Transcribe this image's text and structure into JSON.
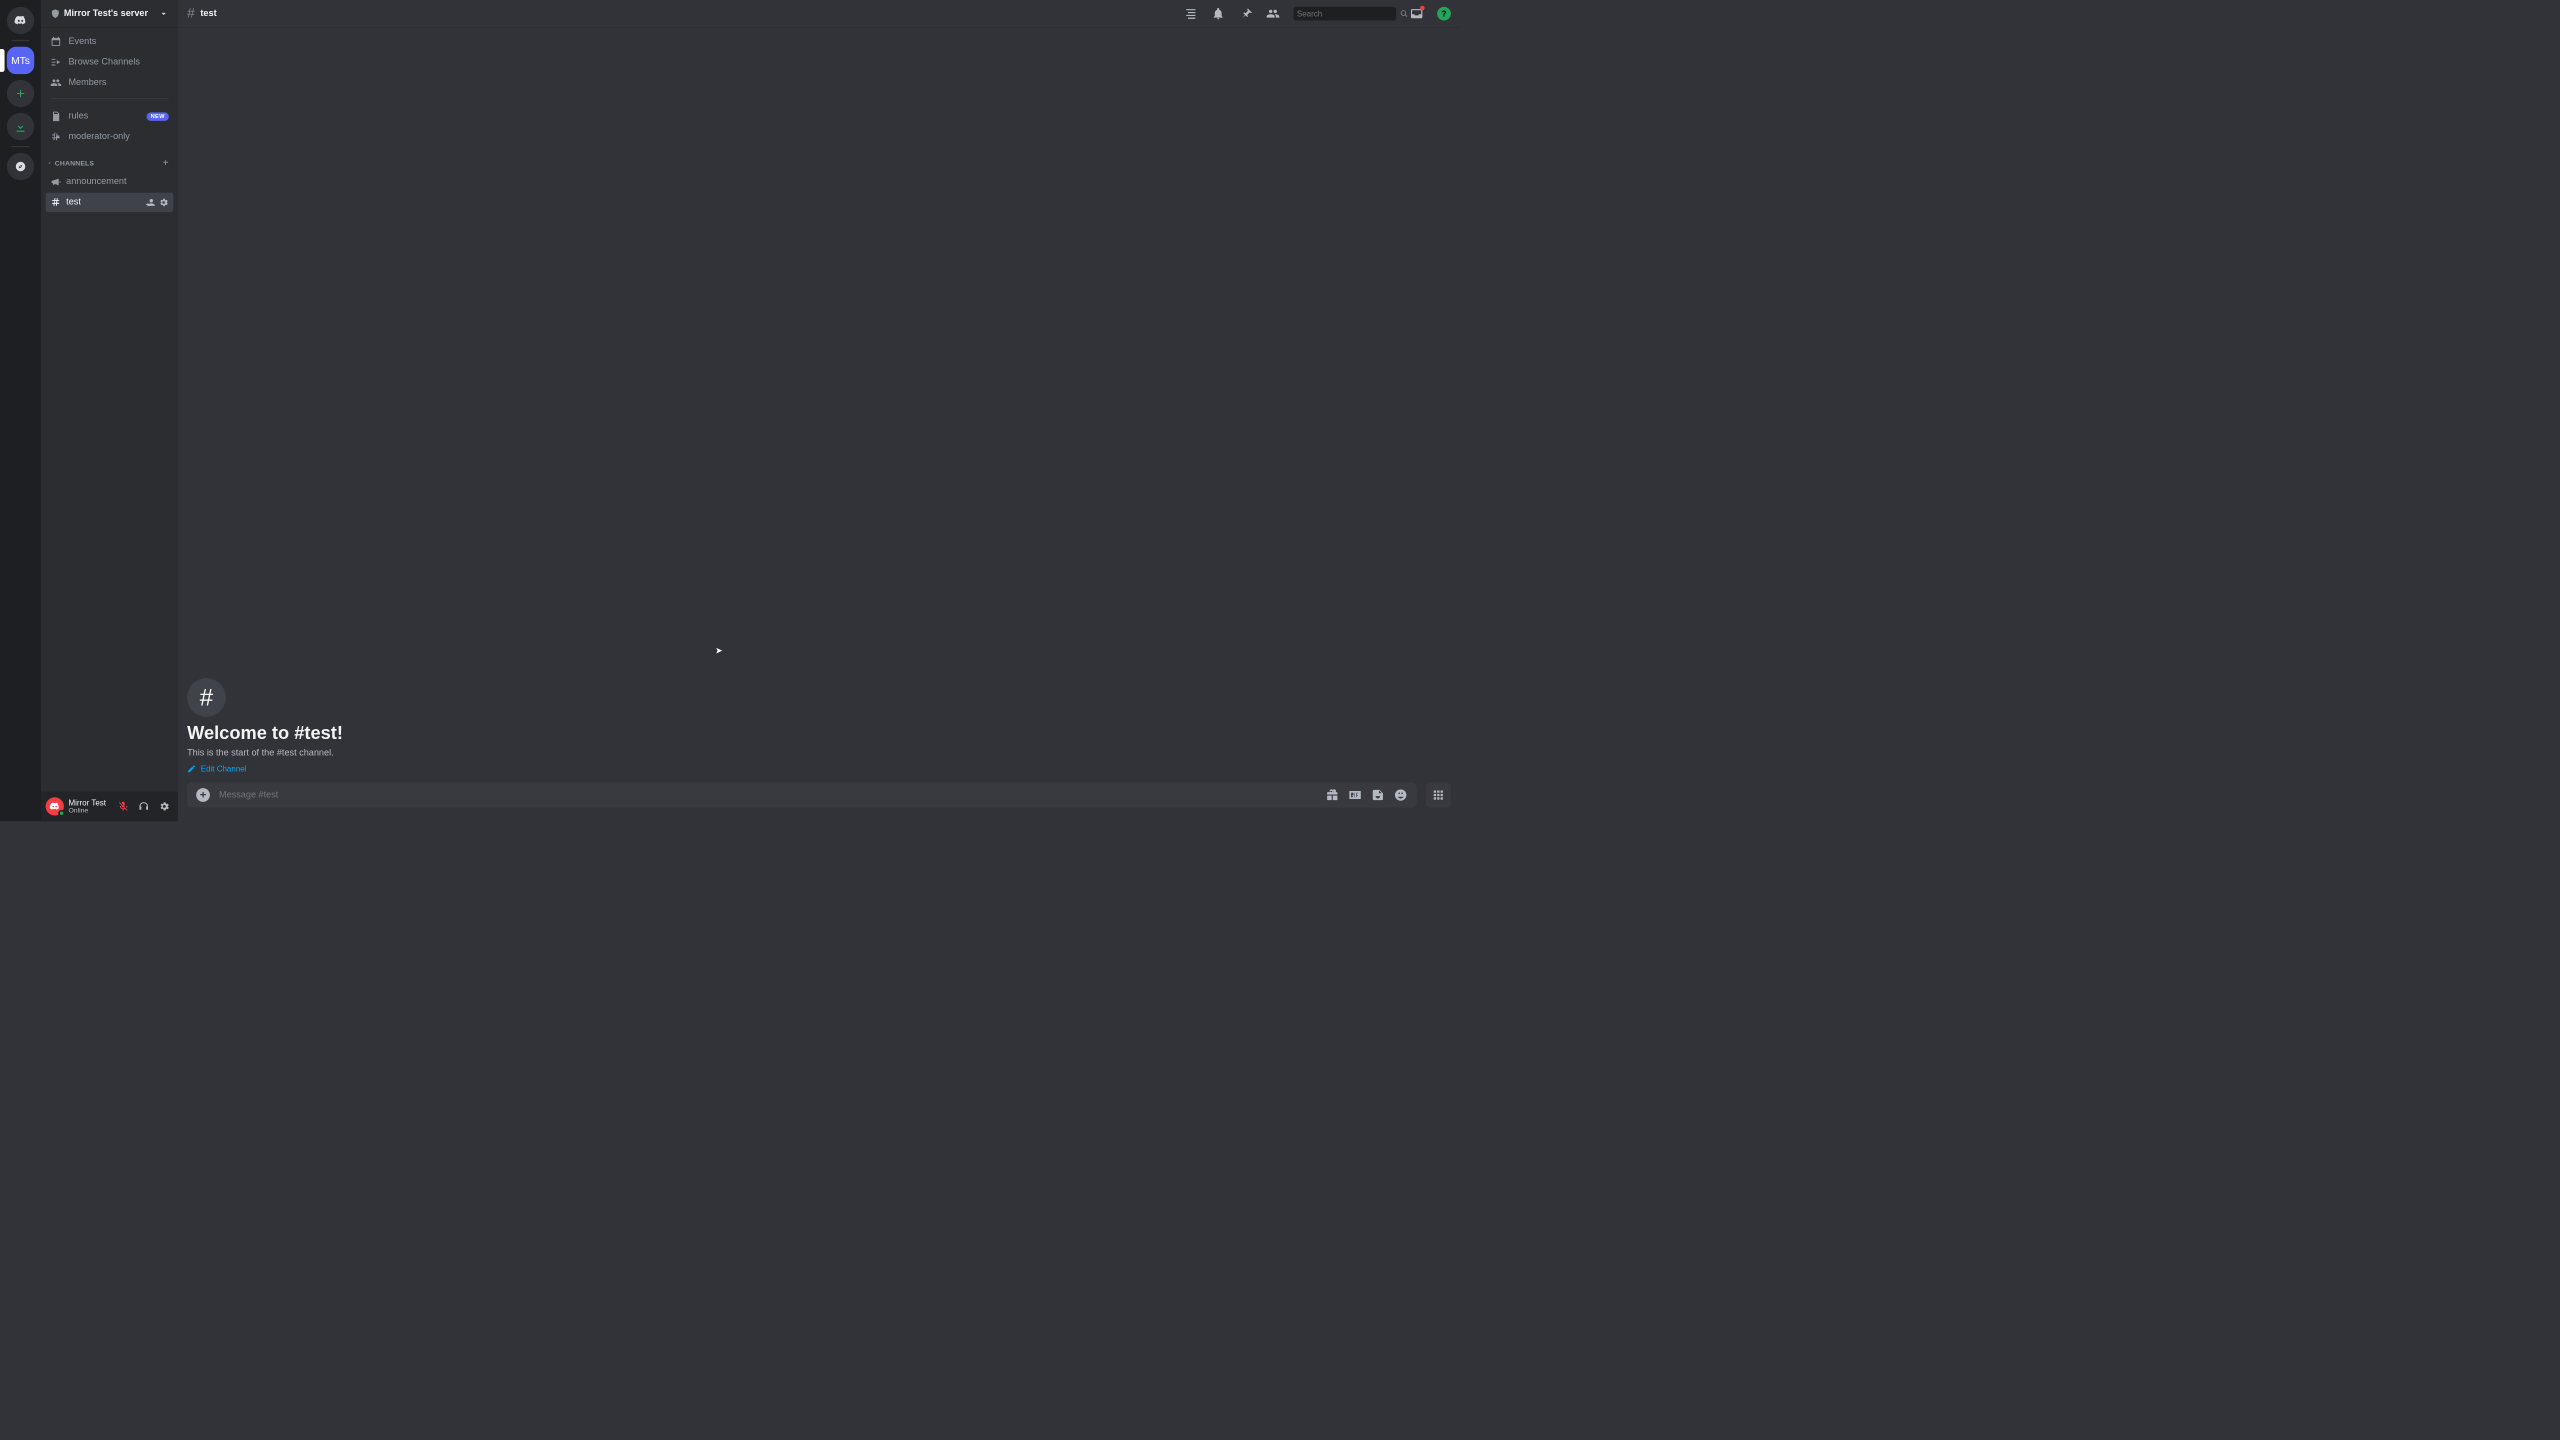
{
  "guilds": {
    "home_label": "Direct Messages",
    "active_server_initials": "MTs",
    "add_server_label": "+",
    "download_label": "⭳",
    "explore_label": "🧭"
  },
  "server": {
    "name": "Mirror Test's server"
  },
  "sidebar": {
    "nav": [
      {
        "label": "Events",
        "icon": "calendar"
      },
      {
        "label": "Browse Channels",
        "icon": "browse"
      },
      {
        "label": "Members",
        "icon": "members"
      }
    ],
    "top_channels": [
      {
        "label": "rules",
        "icon": "rules",
        "badge": "NEW"
      },
      {
        "label": "moderator-only",
        "icon": "hash-shield"
      }
    ],
    "category": {
      "label": "CHANNELS"
    },
    "channels": [
      {
        "label": "announcement",
        "icon": "megaphone",
        "selected": false
      },
      {
        "label": "test",
        "icon": "hash",
        "selected": true
      }
    ]
  },
  "user": {
    "name": "Mirror Test",
    "status": "Online"
  },
  "topbar": {
    "channel": "test",
    "search_placeholder": "Search"
  },
  "welcome": {
    "heading": "Welcome to #test!",
    "sub": "This is the start of the #test channel.",
    "edit_label": "Edit Channel"
  },
  "composer": {
    "placeholder": "Message #test"
  }
}
